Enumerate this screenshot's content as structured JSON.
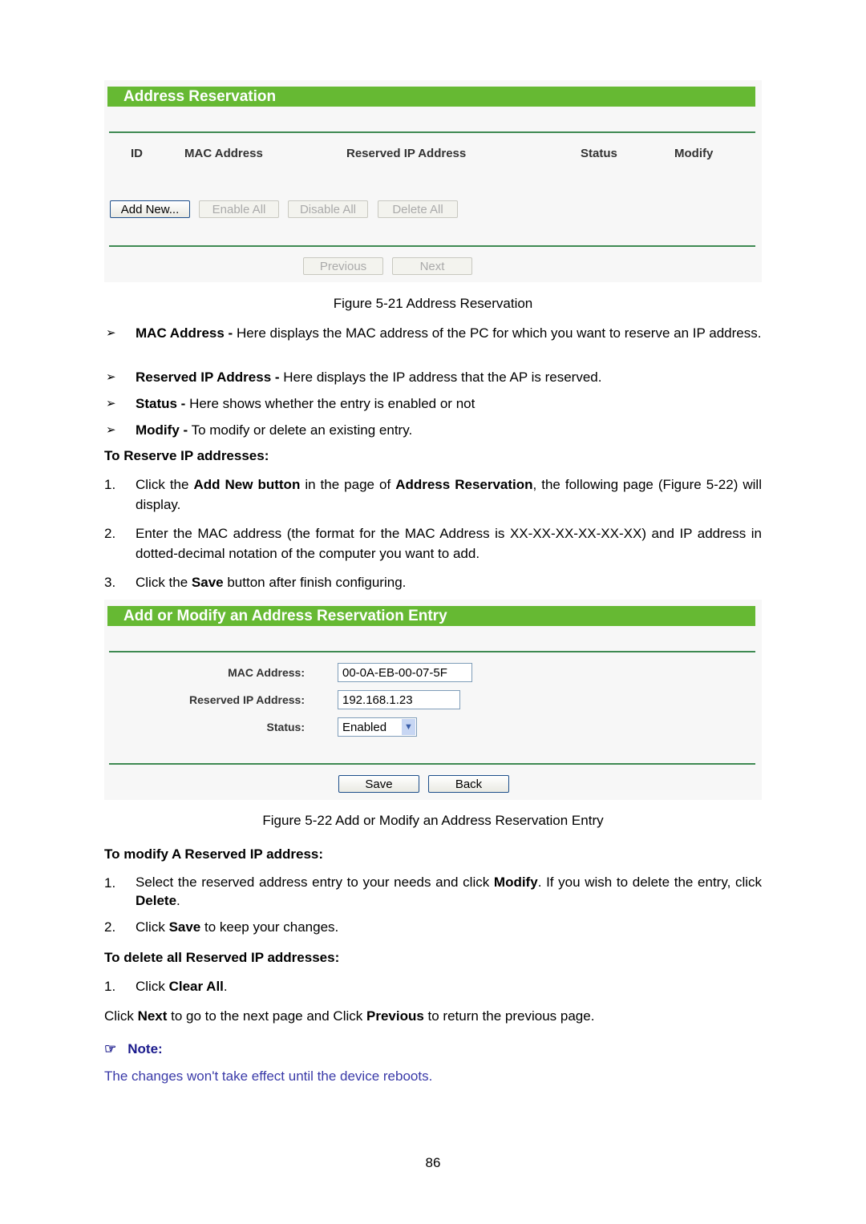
{
  "figure1": {
    "title": "Address Reservation",
    "columns": [
      "ID",
      "MAC Address",
      "Reserved IP Address",
      "Status",
      "Modify"
    ],
    "buttons": [
      "Add New...",
      "Enable All",
      "Disable All",
      "Delete All"
    ],
    "nav": [
      "Previous",
      "Next"
    ],
    "caption": "Figure 5-21 Address Reservation"
  },
  "bullets": [
    {
      "term": "MAC Address -",
      "text": " Here displays the MAC address of the PC for which you want to reserve an IP address."
    },
    {
      "term": "Reserved IP Address -",
      "text": " Here displays the IP address that the AP is reserved."
    },
    {
      "term": "Status -",
      "text": " Here shows whether the entry is enabled or not"
    },
    {
      "term": "Modify -",
      "text": " To modify or delete an existing entry."
    }
  ],
  "reserve": {
    "heading": "To Reserve IP addresses:",
    "steps": [
      {
        "n": "1.",
        "a": "Click the ",
        "b1": "Add New button",
        "c": " in the page of ",
        "b2": "Address Reservation",
        "d": ", the following page (Figure 5-22) will display."
      },
      {
        "n": "2.",
        "a": "Enter the MAC address (the format for the MAC Address is XX-XX-XX-XX-XX-XX) and IP address in dotted-decimal notation of the computer you want to add."
      },
      {
        "n": "3.",
        "a": "Click the ",
        "b1": "Save",
        "c": " button after finish configuring."
      }
    ]
  },
  "figure2": {
    "title": "Add or Modify an Address Reservation Entry",
    "mac_label": "MAC Address:",
    "mac_value": "00-0A-EB-00-07-5F",
    "ip_label": "Reserved IP Address:",
    "ip_value": "192.168.1.23",
    "status_label": "Status:",
    "status_value": "Enabled",
    "save": "Save",
    "back": "Back",
    "caption": "Figure 5-22 Add or Modify an Address Reservation Entry"
  },
  "modify": {
    "heading": "To modify A Reserved IP address:",
    "s1": {
      "n": "1.",
      "a": "Select the reserved address entry to your needs and click ",
      "b1": "Modify",
      "c": ". If you wish to delete the entry, click ",
      "b2": "Delete",
      "d": "."
    },
    "s2": {
      "n": "2.",
      "a": "Click ",
      "b1": "Save",
      "c": " to keep your changes."
    }
  },
  "delete": {
    "heading": "To delete all Reserved IP addresses:",
    "s1": {
      "n": "1.",
      "a": "Click ",
      "b1": "Clear All",
      "c": "."
    }
  },
  "nav_para": {
    "a": "Click ",
    "b1": "Next",
    "c": " to go to the next page and Click ",
    "b2": "Previous",
    "d": " to return the previous page."
  },
  "note": {
    "label": "Note:",
    "text": "The changes won't take effect until the device reboots."
  },
  "page_number": "86"
}
